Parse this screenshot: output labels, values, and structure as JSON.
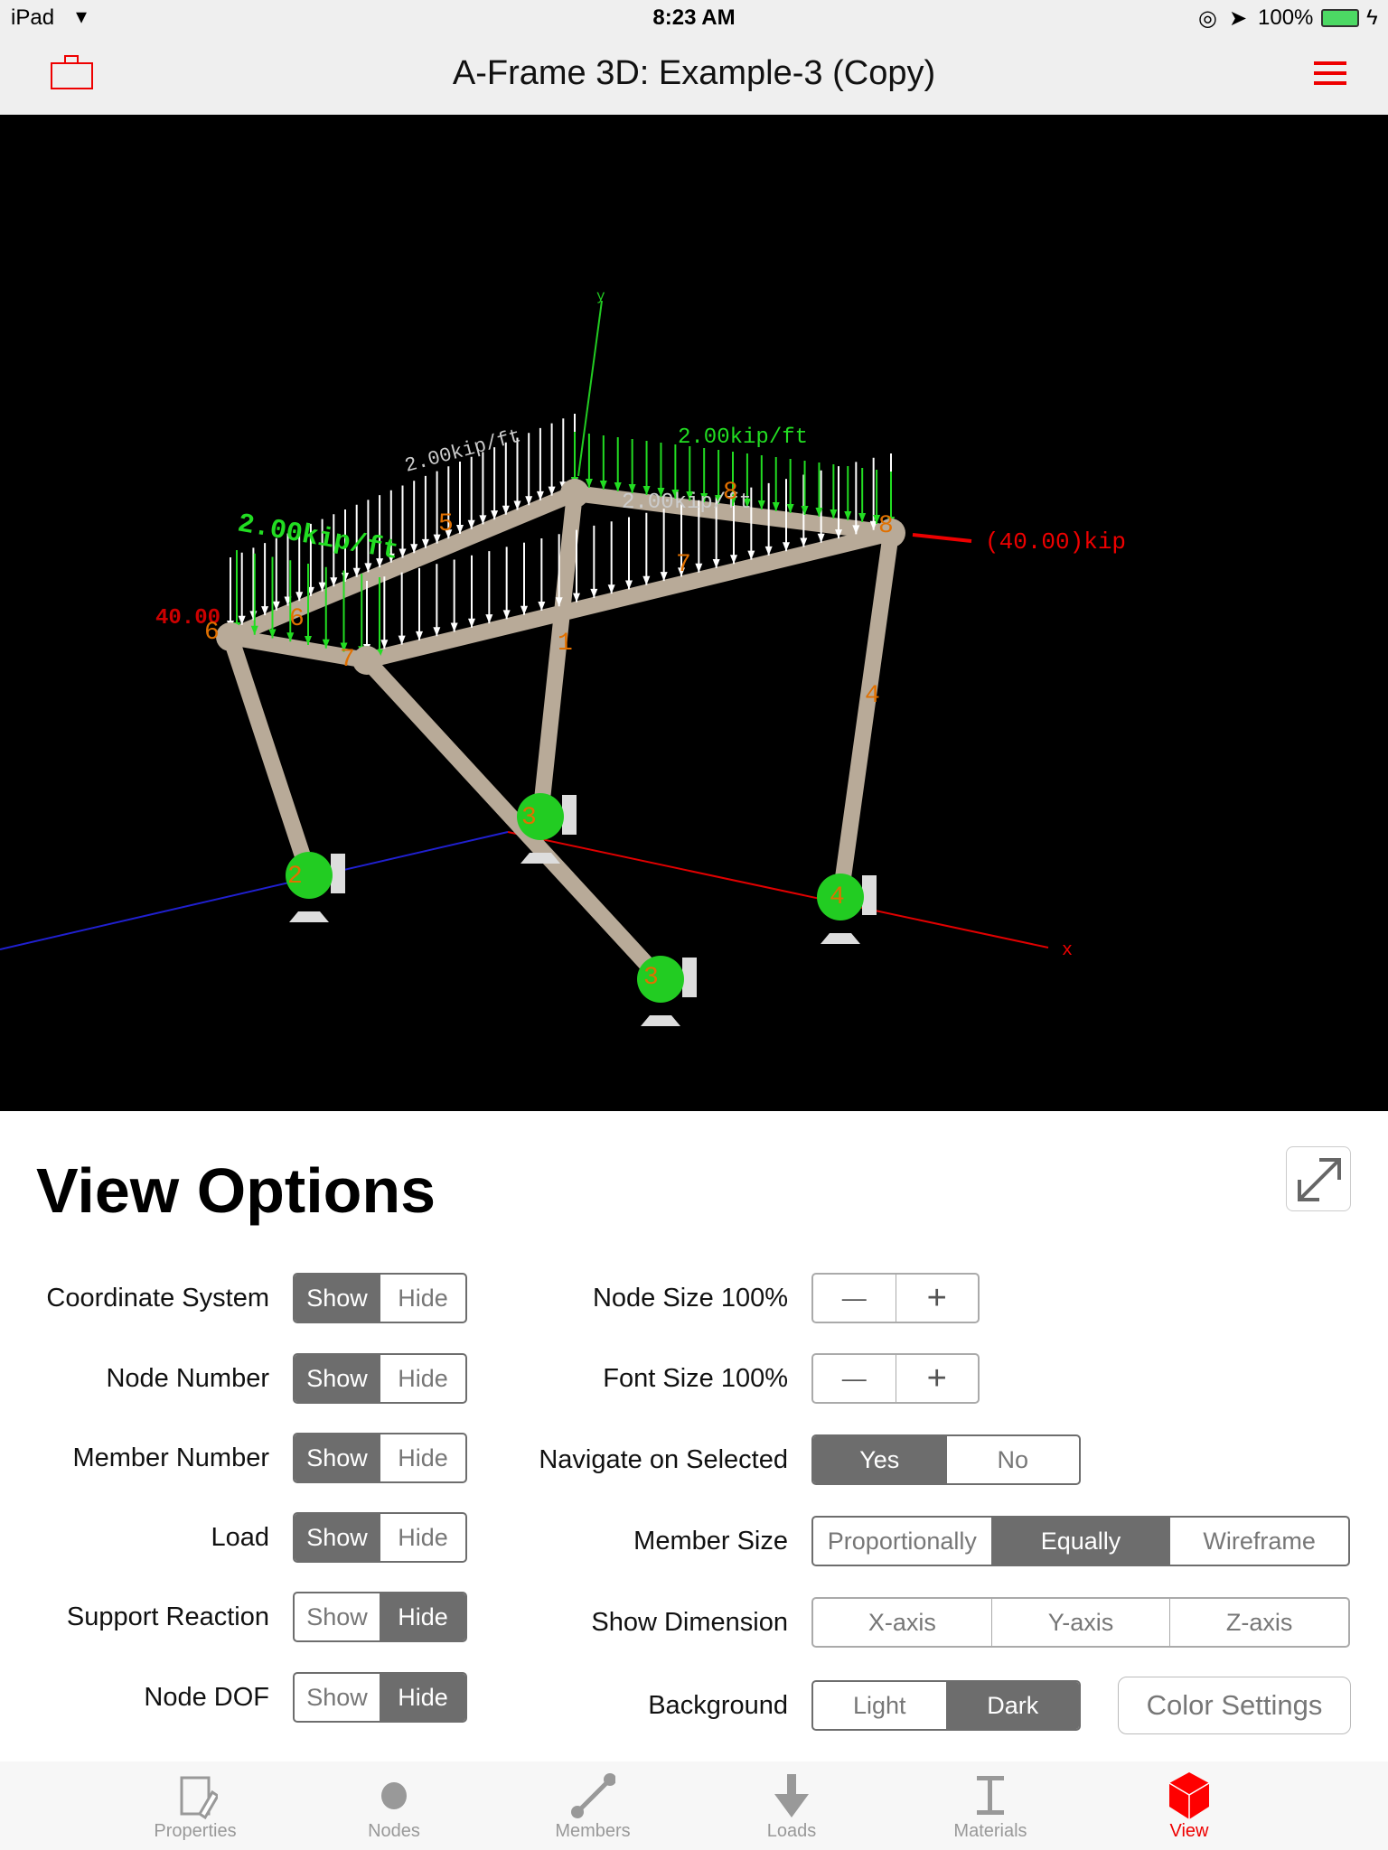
{
  "status": {
    "device": "iPad",
    "time": "8:23 AM",
    "battery": "100%"
  },
  "nav": {
    "title": "A-Frame 3D: Example-3 (Copy)"
  },
  "viewport": {
    "labels": {
      "axis_y": "y",
      "axis_x": "x",
      "load_top_right": "2.00kip/ft",
      "load_back": "2.00kip/ft",
      "load_left": "2.00kip/ft",
      "load_back_white": "2.00kip/ft",
      "point_load_right": "(40.00)kip",
      "point_load_left": "40.00",
      "members": [
        "1",
        "4",
        "5",
        "6",
        "7",
        "8"
      ],
      "nodes": [
        "2",
        "3",
        "3",
        "4",
        "6",
        "7",
        "8"
      ]
    },
    "colors": {
      "members": "#b8aa98",
      "nodes": "#22cc22",
      "x_axis": "#e00000",
      "y_axis": "#22cc22",
      "z_axis": "#2020d0",
      "load_arrows": "#ffffff",
      "load_text": "#22dd22",
      "point_load": "#e00000",
      "labels": "#e07000"
    }
  },
  "panel": {
    "title": "View Options",
    "left_rows": [
      {
        "label": "Coordinate System",
        "options": [
          "Show",
          "Hide"
        ],
        "selected": 0
      },
      {
        "label": "Node Number",
        "options": [
          "Show",
          "Hide"
        ],
        "selected": 0
      },
      {
        "label": "Member Number",
        "options": [
          "Show",
          "Hide"
        ],
        "selected": 0
      },
      {
        "label": "Load",
        "options": [
          "Show",
          "Hide"
        ],
        "selected": 0
      },
      {
        "label": "Support Reaction",
        "options": [
          "Show",
          "Hide"
        ],
        "selected": 1
      },
      {
        "label": "Node DOF",
        "options": [
          "Show",
          "Hide"
        ],
        "selected": 1
      }
    ],
    "node_size": {
      "label": "Node Size 100%",
      "minus": "—",
      "plus": "+"
    },
    "font_size": {
      "label": "Font Size 100%",
      "minus": "—",
      "plus": "+"
    },
    "navigate": {
      "label": "Navigate on Selected",
      "options": [
        "Yes",
        "No"
      ],
      "selected": 0
    },
    "member_size": {
      "label": "Member Size",
      "options": [
        "Proportionally",
        "Equally",
        "Wireframe"
      ],
      "selected": 1
    },
    "dimension": {
      "label": "Show Dimension",
      "options": [
        "X-axis",
        "Y-axis",
        "Z-axis"
      ]
    },
    "background": {
      "label": "Background",
      "options": [
        "Light",
        "Dark"
      ],
      "selected": 1
    },
    "color_settings": "Color Settings"
  },
  "tabs": [
    {
      "label": "Properties",
      "icon": "properties-icon"
    },
    {
      "label": "Nodes",
      "icon": "nodes-icon"
    },
    {
      "label": "Members",
      "icon": "members-icon"
    },
    {
      "label": "Loads",
      "icon": "loads-icon"
    },
    {
      "label": "Materials",
      "icon": "materials-icon"
    },
    {
      "label": "View",
      "icon": "view-cube-icon",
      "active": true
    }
  ]
}
